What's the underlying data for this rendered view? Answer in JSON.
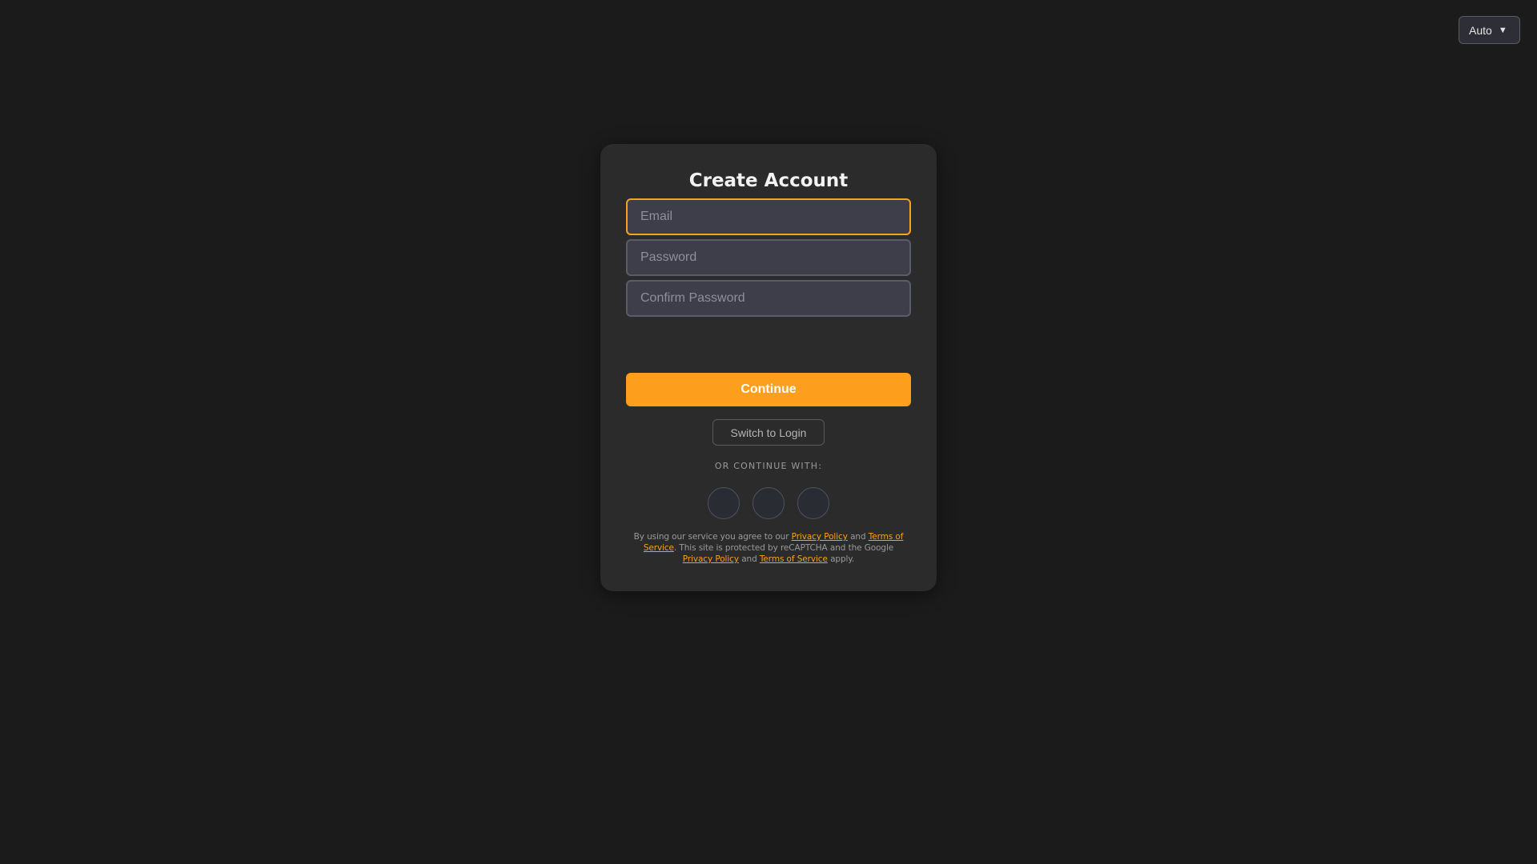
{
  "theme_selector": {
    "value": "Auto"
  },
  "signup": {
    "title": "Create Account",
    "email_placeholder": "Email",
    "password_placeholder": "Password",
    "confirm_password_placeholder": "Confirm Password",
    "continue_label": "Continue",
    "switch_label": "Switch to Login",
    "divider_label": "OR CONTINUE WITH:"
  },
  "legal": {
    "text_1": "By using our service you agree to our ",
    "privacy_link_1": "Privacy Policy",
    "text_2": " and ",
    "terms_link_1": "Terms of Service",
    "text_3": ". This site is protected by reCAPTCHA and the Google ",
    "privacy_link_2": "Privacy Policy",
    "text_4": " and ",
    "terms_link_2": "Terms of Service",
    "text_5": " apply."
  },
  "colors": {
    "background": "#1b1b1b",
    "card": "#2b2b2b",
    "accent": "#fd9f1c",
    "input": "#3d3e4a"
  }
}
